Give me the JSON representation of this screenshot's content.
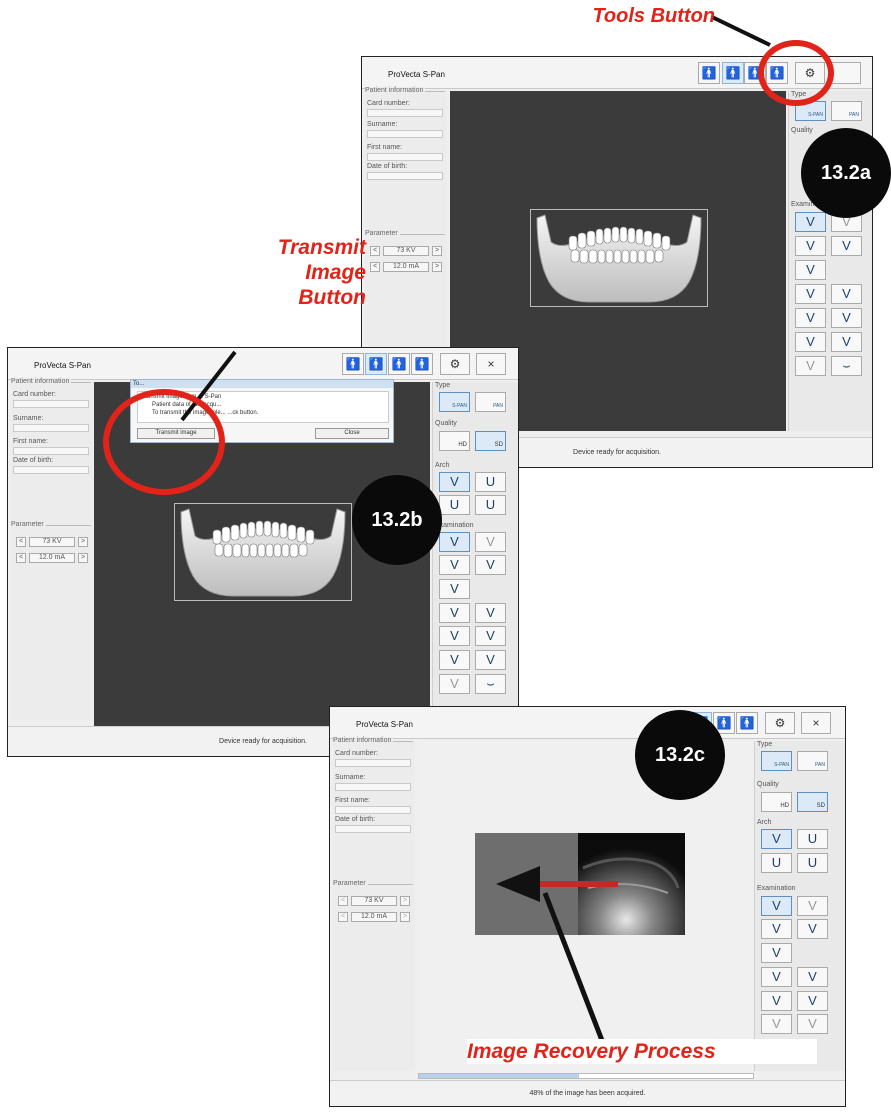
{
  "annotations": {
    "tools_button": "Tools Button",
    "transmit_image_button": "Transmit\nImage\nButton",
    "image_recovery": "Image Recovery Process",
    "badge_a": "13.2a",
    "badge_b": "13.2b",
    "badge_c": "13.2c",
    "accent_color": "#e2231a"
  },
  "app": {
    "title": "ProVecta S-Pan",
    "patient_header": "Patient information",
    "card_number": "Card number:",
    "surname": "Surname:",
    "first_name": "First name:",
    "date_of_birth": "Date of birth:",
    "parameter_header": "Parameter",
    "kv": "73 KV",
    "ma": "12.0 mA",
    "dec": "<",
    "inc": ">",
    "type_header": "Type",
    "type_span": "S-PAN",
    "type_pan": "PAN",
    "quality_header": "Quality",
    "quality_hd": "HD",
    "quality_sd": "SD",
    "arch_header": "Arch",
    "examination_header": "Examination",
    "close_symbol": "×",
    "status_ready": "Device ready for acquisition."
  },
  "dialog": {
    "title": "To...",
    "line1": "...ansmit image from ... S-Pan",
    "line2": "Patient data of last acqu...",
    "line3": "To transmit the image, ple... ...ck button.",
    "transmit_button": "Transmit image",
    "close_button": "Close"
  },
  "recovery": {
    "status": "48% of the image has been acquired.",
    "progress": 0.48
  }
}
